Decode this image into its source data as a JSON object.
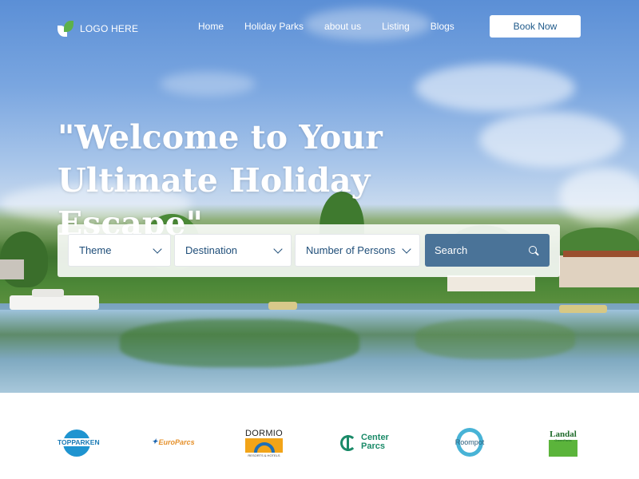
{
  "brand": {
    "logo_text": "LOGO HERE",
    "accent": "#1f5a8a",
    "logo_leaf_color": "#5db14a"
  },
  "nav": {
    "items": [
      {
        "label": "Home"
      },
      {
        "label": "Holiday Parks"
      },
      {
        "label": "about us"
      },
      {
        "label": "Listing"
      },
      {
        "label": "Blogs"
      }
    ],
    "cta_label": "Book Now"
  },
  "hero": {
    "headline_line1": "\"Welcome to Your",
    "headline_line2": "Ultimate Holiday Escape\""
  },
  "search": {
    "theme_label": "Theme",
    "destination_label": "Destination",
    "persons_label": "Number of Persons",
    "search_label": "Search",
    "search_button_color": "#4a7398"
  },
  "partners": {
    "topparken": "TOPPARKEN",
    "europarcs": "EuroParcs",
    "dormio": "DORMIO",
    "dormio_sub": "RESORTS & HOTELS",
    "center_parcs_line1": "Center",
    "center_parcs_line2": "Parcs",
    "roompot": "Roompot",
    "landal": "Landal",
    "landal_sub": "GreenParks"
  }
}
